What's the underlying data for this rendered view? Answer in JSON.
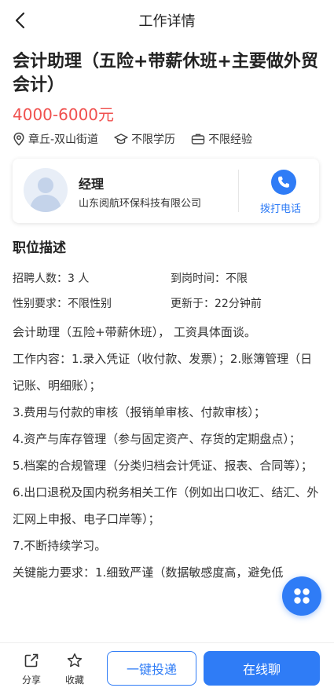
{
  "header": {
    "title": "工作详情"
  },
  "job": {
    "title": "会计助理（五险+带薪休班+主要做外贸会计）",
    "salary": "4000-6000元",
    "location": "章丘-双山街道",
    "education": "不限学历",
    "experience": "不限经验"
  },
  "contact": {
    "name": "经理",
    "company": "山东阅航环保科技有限公司",
    "call_label": "拨打电话"
  },
  "section": {
    "title": "职位描述"
  },
  "info": {
    "recruit": "招聘人数：3 人",
    "arrival": "到岗时间：不限",
    "gender": "性别要求：不限性别",
    "updated": "更新于：22分钟前"
  },
  "description": [
    "会计助理（五险+带薪休班），  工资具体面谈。",
    "工作内容：1.录入凭证（收付款、发票）；2.账簿管理（日记账、明细账）；",
    "3.费用与付款的审核（报销单审核、付款审核）；",
    "4.资产与库存管理（参与固定资产、存货的定期盘点）；",
    "5.档案的合规管理（分类归档会计凭证、报表、合同等）；",
    "6.出口退税及国内税务相关工作（例如出口收汇、结汇、外汇网上申报、电子口岸等）；",
    "7.不断持续学习。",
    "关键能力要求：1.细致严谨（数据敏感度高，避免低"
  ],
  "bottom": {
    "share": "分享",
    "favorite": "收藏",
    "apply": "一键投递",
    "chat": "在线聊"
  },
  "colors": {
    "accent": "#2f7cf6",
    "salary": "#f0514f"
  }
}
